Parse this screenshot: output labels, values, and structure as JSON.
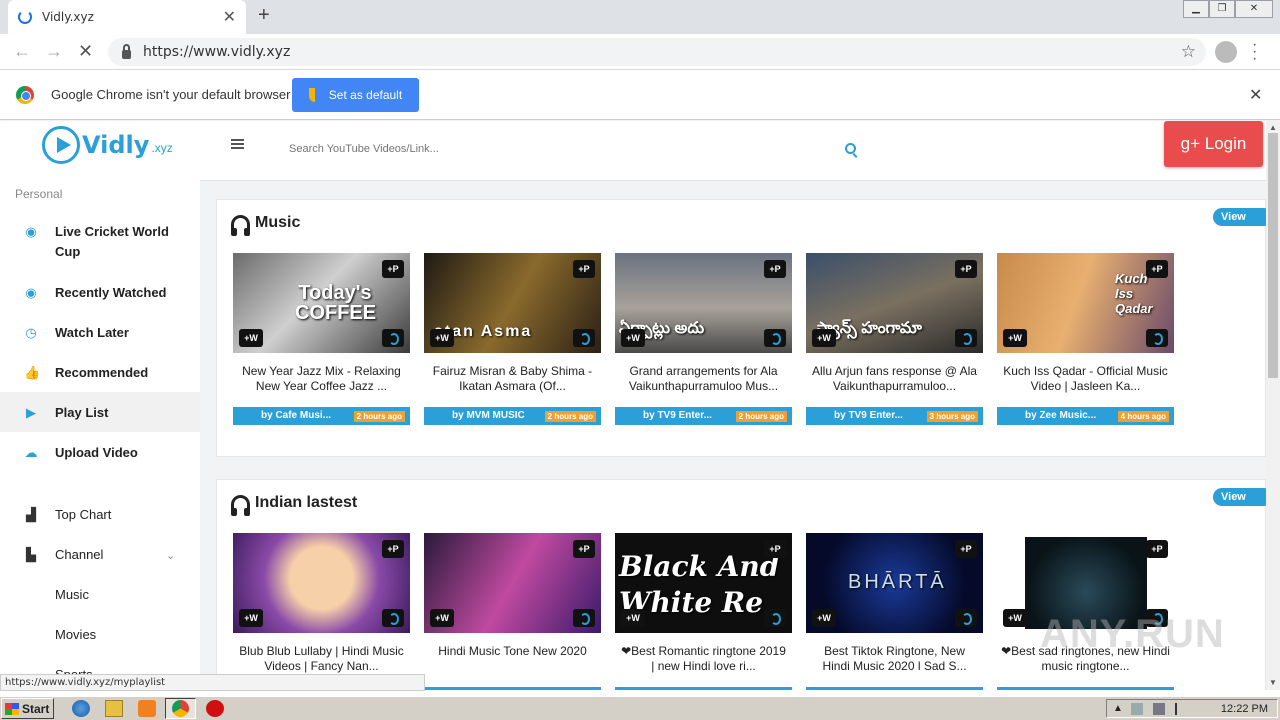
{
  "browser": {
    "tab_title": "Vidly.xyz",
    "url": "https://www.vidly.xyz",
    "infobar_text": "Google Chrome isn't your default browser",
    "set_default_label": "Set as default",
    "status_url": "https://www.vidly.xyz/myplaylist"
  },
  "site": {
    "logo_name": "Vidly",
    "logo_tld": ".xyz",
    "section_label": "Personal",
    "search_placeholder": "Search YouTube Videos/Link...",
    "login_label": "g+ Login",
    "accent": "#2a9fd8"
  },
  "sidebar": {
    "items": [
      {
        "label": "Live Cricket World Cup",
        "icon": "eye-icon"
      },
      {
        "label": "Recently Watched",
        "icon": "eye-icon"
      },
      {
        "label": "Watch Later",
        "icon": "clock-icon"
      },
      {
        "label": "Recommended",
        "icon": "thumbs-up-icon"
      },
      {
        "label": "Play List",
        "icon": "play-icon"
      },
      {
        "label": "Upload Video",
        "icon": "upload-cloud-icon"
      }
    ],
    "plain_items": [
      {
        "label": "Top Chart",
        "icon": "bar-chart-icon"
      },
      {
        "label": "Channel",
        "icon": "file-icon"
      }
    ],
    "sub_items": [
      "Music",
      "Movies",
      "Sports"
    ]
  },
  "sections": [
    {
      "title": "Music",
      "view_more": "View More",
      "cards": [
        {
          "title": "New Year Jazz Mix - Relaxing New Year Coffee Jazz ...",
          "by": "by Cafe Musi...",
          "time": "2 hours ago",
          "thumb_text": "Today's COFFEE"
        },
        {
          "title": "Fairuz Misran & Baby Shima - Ikatan Asmara (Of...",
          "by": "by MVM MUSIC",
          "time": "2 hours ago",
          "thumb_text": "atan Asma"
        },
        {
          "title": "Grand arrangements for Ala Vaikunthapurramuloo Mus...",
          "by": "by TV9 Enter...",
          "time": "2 hours ago",
          "thumb_text": "ఏర్పాట్లు అదు"
        },
        {
          "title": "Allu Arjun fans response @ Ala Vaikunthapurramuloo...",
          "by": "by TV9 Enter...",
          "time": "3 hours ago",
          "thumb_text": "ఫ్యాన్స్ హంగామా"
        },
        {
          "title": "Kuch Iss Qadar - Official Music Video | Jasleen Ka...",
          "by": "by Zee Music...",
          "time": "4 hours ago",
          "thumb_text": "Kuch Iss Qadar"
        }
      ]
    },
    {
      "title": "Indian lastest",
      "view_more": "View More",
      "cards": [
        {
          "title": "Blub Blub Lullaby | Hindi Music Videos | Fancy Nan...",
          "thumb_text": ""
        },
        {
          "title": "Hindi Music Tone New 2020",
          "thumb_text": ""
        },
        {
          "title": "❤Best Romantic ringtone 2019 | new Hindi love ri...",
          "thumb_text": "Black And White Re"
        },
        {
          "title": "Best Tiktok Ringtone, New Hindi Music 2020 l Sad S...",
          "thumb_text": "BHĀRTĀ"
        },
        {
          "title": "❤Best sad ringtones, new Hindi music ringtone...",
          "thumb_text": ""
        }
      ]
    }
  ],
  "badges": {
    "p": "+P",
    "w": "+W"
  },
  "taskbar": {
    "start_label": "Start",
    "clock": "12:22 PM"
  },
  "watermark": "ANY.RUN"
}
